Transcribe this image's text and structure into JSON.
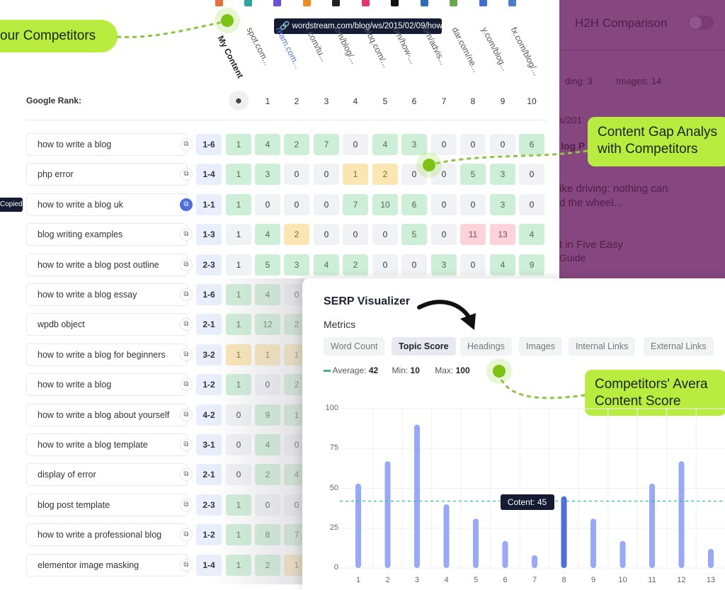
{
  "callouts": {
    "competitors": "our Competitors",
    "gap_line1": "Content Gap Analys",
    "gap_line2": "with Competitors",
    "avg_line1": "Competitors' Avera",
    "avg_line2": "Content Score"
  },
  "tooltip_url": "wordstream.com/blog/ws/2015/02/09/how...",
  "columns": [
    {
      "label": "My Content",
      "color": "#e8703a"
    },
    {
      "label": "spot.com...",
      "color": "#2aa8a0"
    },
    {
      "label": "ream.com...",
      "color": "#6b4fd8",
      "highlight": true
    },
    {
      "label": "r.com/tu...",
      "color": "#f28a1e"
    },
    {
      "label": "om/blog/...",
      "color": "#222222"
    },
    {
      "label": "bloq.com/...",
      "color": "#e8336d"
    },
    {
      "label": "om/how-...",
      "color": "#111111"
    },
    {
      "label": "om/advis...",
      "color": "#2a6fb5"
    },
    {
      "label": "dar.com/ne...",
      "color": "#6aa84f"
    },
    {
      "label": "y.com/blog...",
      "color": "#3b6fd1"
    },
    {
      "label": "fx.com/blog/...",
      "color": "#4a7bd0"
    }
  ],
  "google_rank_label": "Google Rank:",
  "rank_headers": [
    "1",
    "2",
    "3",
    "4",
    "5",
    "6",
    "7",
    "8",
    "9",
    "10"
  ],
  "copied_label": "Copied",
  "rows": [
    {
      "keyword": "how to write a blog",
      "rank": "1-6",
      "values": [
        1,
        4,
        2,
        7,
        0,
        4,
        3,
        0,
        0,
        0,
        6
      ],
      "status": [
        "g",
        "g",
        "g",
        "g",
        "z",
        "g",
        "g",
        "z",
        "z",
        "z",
        "g"
      ]
    },
    {
      "keyword": "php error",
      "rank": "1-4",
      "values": [
        1,
        3,
        0,
        0,
        1,
        2,
        0,
        0,
        5,
        3,
        0
      ],
      "status": [
        "g",
        "g",
        "z",
        "z",
        "y",
        "y",
        "z",
        "z",
        "g",
        "g",
        "z"
      ]
    },
    {
      "keyword": "how to write a blog uk",
      "rank": "1-1",
      "values": [
        1,
        0,
        0,
        0,
        7,
        10,
        6,
        0,
        0,
        3,
        0
      ],
      "status": [
        "g",
        "z",
        "z",
        "z",
        "g",
        "g",
        "g",
        "z",
        "z",
        "g",
        "z"
      ],
      "copied": true
    },
    {
      "keyword": "blog writing examples",
      "rank": "1-3",
      "values": [
        1,
        4,
        2,
        0,
        0,
        0,
        5,
        0,
        11,
        13,
        4
      ],
      "status": [
        "z",
        "g",
        "y",
        "z",
        "z",
        "z",
        "g",
        "z",
        "r",
        "r",
        "g"
      ]
    },
    {
      "keyword": "how to write a blog post outline",
      "rank": "2-3",
      "values": [
        1,
        5,
        3,
        4,
        2,
        0,
        0,
        3,
        0,
        4,
        9
      ],
      "status": [
        "z",
        "g",
        "g",
        "g",
        "g",
        "z",
        "z",
        "g",
        "z",
        "g",
        "g"
      ]
    },
    {
      "keyword": "how to write a blog essay",
      "rank": "1-6",
      "values": [
        1,
        4,
        0
      ],
      "status": [
        "g",
        "g",
        "z"
      ]
    },
    {
      "keyword": "wpdb object",
      "rank": "2-1",
      "values": [
        1,
        12,
        2
      ],
      "status": [
        "g",
        "g",
        "g"
      ]
    },
    {
      "keyword": "how to write a blog for beginners",
      "rank": "3-2",
      "values": [
        1,
        1,
        1
      ],
      "status": [
        "y",
        "y",
        "y"
      ]
    },
    {
      "keyword": "how to write a blog",
      "rank": "1-2",
      "values": [
        1,
        0,
        2
      ],
      "status": [
        "g",
        "z",
        "g"
      ]
    },
    {
      "keyword": "how to write a blog about yourself",
      "rank": "4-2",
      "values": [
        0,
        9,
        1
      ],
      "status": [
        "z",
        "g",
        "g"
      ]
    },
    {
      "keyword": "how to write a blog template",
      "rank": "3-1",
      "values": [
        0,
        4,
        0
      ],
      "status": [
        "z",
        "g",
        "z"
      ]
    },
    {
      "keyword": "display of error",
      "rank": "2-1",
      "values": [
        0,
        2,
        4
      ],
      "status": [
        "z",
        "g",
        "g"
      ]
    },
    {
      "keyword": "blog post template",
      "rank": "2-3",
      "values": [
        1,
        0,
        0
      ],
      "status": [
        "g",
        "z",
        "z"
      ]
    },
    {
      "keyword": "how to write a professional blog",
      "rank": "1-2",
      "values": [
        1,
        8,
        7
      ],
      "status": [
        "g",
        "g",
        "g"
      ]
    },
    {
      "keyword": "elementor image masking",
      "rank": "1-4",
      "values": [
        1,
        2,
        1
      ],
      "status": [
        "g",
        "g",
        "y"
      ]
    }
  ],
  "h2h": {
    "title": "H2H Comparison",
    "heading": "ding: 3",
    "images": "Images: 14",
    "url": "s/201",
    "line1": "log P",
    "snippet1": "ike driving: nothing can",
    "snippet2": "d the wheel...",
    "snippet3": "t in Five Easy",
    "snippet4": "Guide",
    "overlay_color": "#86467f"
  },
  "serp": {
    "title": "SERP Visualizer",
    "metrics_label": "Metrics",
    "tabs": [
      "Word Count",
      "Topic Score",
      "Headings",
      "Images",
      "Internal Links",
      "External Links"
    ],
    "active_tab": "Topic Score",
    "average_label": "Average:",
    "average": "42",
    "min_label": "Min:",
    "min": "10",
    "max_label": "Max:",
    "max": "100"
  },
  "chart_data": {
    "type": "bar",
    "categories": [
      "1",
      "2",
      "3",
      "4",
      "5",
      "6",
      "7",
      "8",
      "9",
      "10",
      "11",
      "12",
      "13"
    ],
    "values": [
      53,
      67,
      90,
      40,
      31,
      17,
      8,
      45,
      31,
      17,
      53,
      67,
      12
    ],
    "highlight_index": 7,
    "average": 42,
    "ylim": [
      0,
      100
    ],
    "yticks": [
      "0",
      "25",
      "50",
      "75",
      "100"
    ],
    "tooltip": "Cotent: 45",
    "grid": true,
    "colors": {
      "bar": "#98a9fb",
      "highlight": "#4d6ee3",
      "average": "#3fb58a"
    }
  }
}
